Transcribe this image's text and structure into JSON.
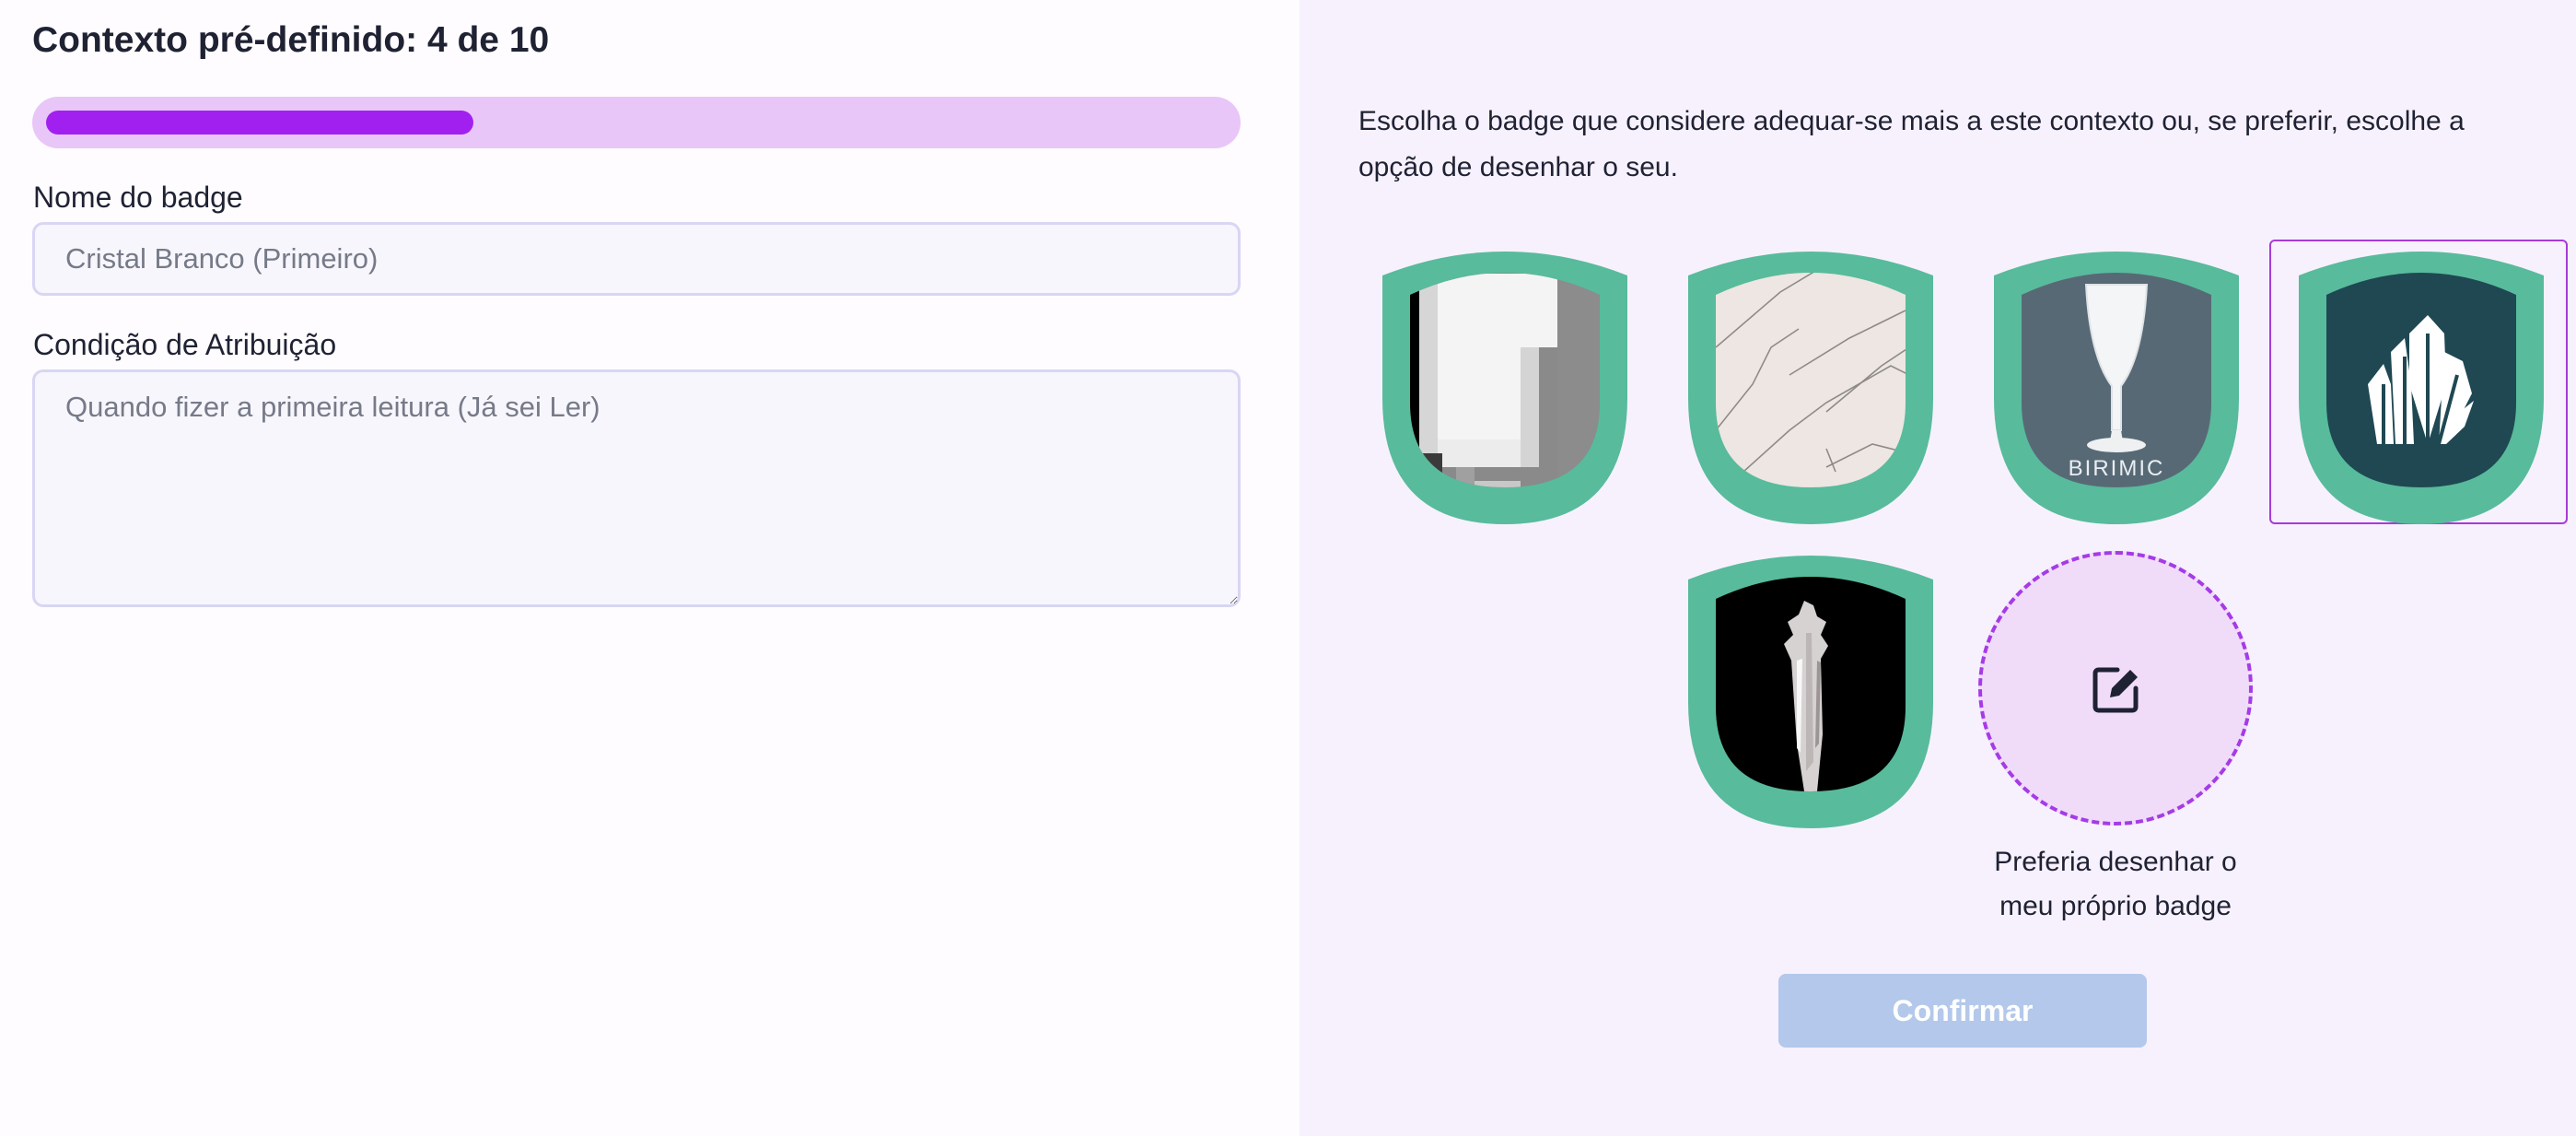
{
  "header": {
    "title": "Contexto pré-definido: 4 de 10"
  },
  "progress": {
    "current": 4,
    "total": 10,
    "fraction": 0.4
  },
  "form": {
    "name_label": "Nome do badge",
    "name_placeholder": "Cristal Branco (Primeiro)",
    "condition_label": "Condição de Atribuição",
    "condition_placeholder": "Quando fizer a primeira leitura (Já sei Ler)"
  },
  "picker": {
    "instructions": "Escolha o badge que considere adequar-se mais a este contexto ou, se preferir, escolhe a opção de desenhar o seu.",
    "badges": [
      {
        "name": "white-pixel-crystal",
        "selected": false
      },
      {
        "name": "cracked-marble",
        "selected": false
      },
      {
        "name": "glass-goblet",
        "caption": "BIRIMIC",
        "selected": false
      },
      {
        "name": "crystal-cluster",
        "selected": true
      },
      {
        "name": "quartz-crystal",
        "selected": false
      }
    ],
    "draw_option_label": "Preferia desenhar o meu próprio badge",
    "confirm_label": "Confirmar"
  },
  "colors": {
    "accent": "#a120f0",
    "progress_track": "#e8c6f8",
    "badge_border": "#58bb9c",
    "selection_outline": "#a83ad8",
    "confirm_disabled": "#b3c8ea"
  }
}
